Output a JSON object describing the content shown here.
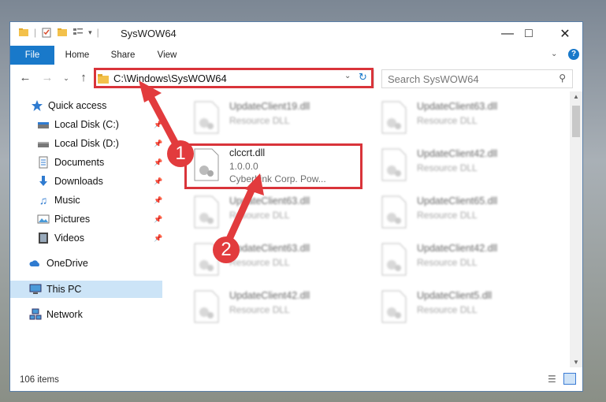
{
  "window": {
    "title": "SysWOW64",
    "min_icon": "minimize-icon",
    "max_icon": "maximize-icon",
    "close_icon": "close-icon"
  },
  "ribbon": {
    "tabs": [
      "File",
      "Home",
      "Share",
      "View"
    ]
  },
  "address": {
    "path": "C:\\Windows\\SysWOW64",
    "search_placeholder": "Search SysWOW64"
  },
  "sidebar": {
    "items": [
      {
        "label": "Quick access",
        "icon": "star-icon",
        "pinned": false
      },
      {
        "label": "Local Disk (C:)",
        "icon": "drive-icon",
        "pinned": true
      },
      {
        "label": "Local Disk (D:)",
        "icon": "drive-icon",
        "pinned": true
      },
      {
        "label": "Documents",
        "icon": "documents-icon",
        "pinned": true
      },
      {
        "label": "Downloads",
        "icon": "downloads-icon",
        "pinned": true
      },
      {
        "label": "Music",
        "icon": "music-icon",
        "pinned": true
      },
      {
        "label": "Pictures",
        "icon": "pictures-icon",
        "pinned": true
      },
      {
        "label": "Videos",
        "icon": "videos-icon",
        "pinned": true
      },
      {
        "label": "OneDrive",
        "icon": "cloud-icon",
        "pinned": false
      },
      {
        "label": "This PC",
        "icon": "computer-icon",
        "pinned": false
      },
      {
        "label": "Network",
        "icon": "network-icon",
        "pinned": false
      }
    ]
  },
  "files": {
    "left_col": [
      {
        "name": "UpdateClient19.dll",
        "sub": "Resource DLL"
      },
      {
        "name": "clccrt.dll",
        "sub": "1.0.0.0",
        "sub2": "CyberLink Corp. Pow..."
      },
      {
        "name": "UpdateClient63.dll",
        "sub": "Resource DLL"
      },
      {
        "name": "UpdateClient63.dll",
        "sub": "Resource DLL"
      },
      {
        "name": "UpdateClient42.dll",
        "sub": "Resource DLL"
      }
    ],
    "right_col": [
      {
        "name": "UpdateClient63.dll",
        "sub": "Resource DLL"
      },
      {
        "name": "UpdateClient42.dll",
        "sub": "Resource DLL"
      },
      {
        "name": "UpdateClient65.dll",
        "sub": "Resource DLL"
      },
      {
        "name": "UpdateClient42.dll",
        "sub": "Resource DLL"
      },
      {
        "name": "UpdateClient5.dll",
        "sub": "Resource DLL"
      }
    ]
  },
  "status": {
    "count": "106 items"
  },
  "annotations": {
    "badge1": "1",
    "badge2": "2"
  },
  "colors": {
    "accent": "#1979ca",
    "highlight": "#d9343a"
  }
}
